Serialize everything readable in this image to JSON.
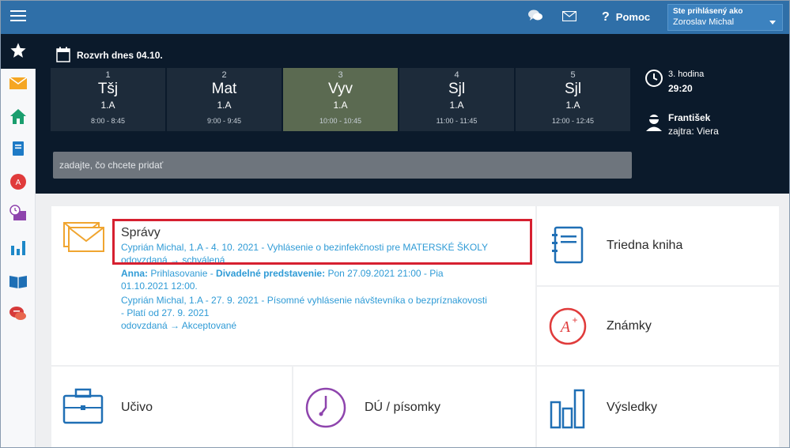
{
  "topbar": {
    "help_label": "Pomoc",
    "user_caption": "Ste prihlásený ako",
    "user_name": "Zoroslav Michal"
  },
  "sidebar": {
    "items": [
      "star-icon",
      "envelope-icon",
      "home-icon",
      "book-icon",
      "grade-icon",
      "schedule-icon",
      "chart-icon",
      "open-book-icon",
      "chat-icon"
    ]
  },
  "schedule": {
    "title": "Rozvrh dnes 04.10.",
    "lessons": [
      {
        "num": "1",
        "subject": "Tšj",
        "class": "1.A",
        "time": "8:00 - 8:45"
      },
      {
        "num": "2",
        "subject": "Mat",
        "class": "1.A",
        "time": "9:00 - 9:45"
      },
      {
        "num": "3",
        "subject": "Vyv",
        "class": "1.A",
        "time": "10:00 - 10:45"
      },
      {
        "num": "4",
        "subject": "Sjl",
        "class": "1.A",
        "time": "11:00 - 11:45"
      },
      {
        "num": "5",
        "subject": "Sjl",
        "class": "1.A",
        "time": "12:00 - 12:45"
      }
    ],
    "current_hour": "3. hodina",
    "countdown": "29:20",
    "person_today": "František",
    "person_tomorrow": "zajtra: Viera",
    "add_placeholder": "zadajte, čo chcete pridať"
  },
  "messages": {
    "title": "Správy",
    "m1_line1": "Cyprián Michal, 1.A - 4. 10. 2021 - Vyhlásenie o bezinfekčnosti pre MATERSKÉ ŠKOLY",
    "m1_line2": "odovzdaná → schválená",
    "m2_name": "Anna:",
    "m2_text1": " Prihlasovanie - ",
    "m2_bold": "Divadelné predstavenie:",
    "m2_text2": " Pon 27.09.2021 21:00 - Pia",
    "m2_line2": "01.10.2021 12:00.",
    "m3_line1": "Cyprián Michal, 1.A - 27. 9. 2021 - Písomné vyhlásenie návštevníka o bezpríznakovosti",
    "m3_line2": "- Platí od 27. 9. 2021",
    "m3_line3": "odovzdaná → Akceptované"
  },
  "tiles": {
    "class_book": "Triedna kniha",
    "grades": "Známky",
    "curriculum": "Učivo",
    "homework": "DÚ / písomky",
    "results": "Výsledky"
  },
  "colors": {
    "topbar": "#2f6fa8",
    "dark_panel": "#0b1a2b",
    "active_lesson": "#5b6a51",
    "link_blue": "#2f9bd6",
    "highlight_red": "#d62030"
  }
}
